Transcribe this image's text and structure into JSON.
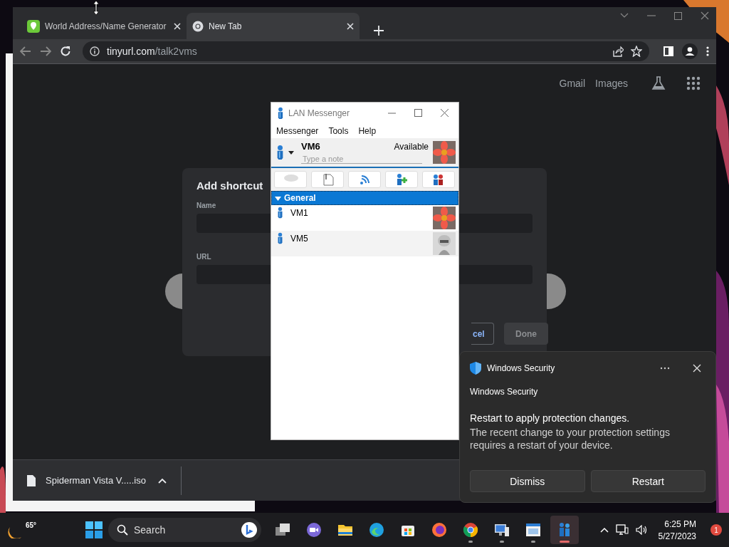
{
  "browser": {
    "tabs": [
      {
        "title": "World Address/Name Generator",
        "selected": false
      },
      {
        "title": "New Tab",
        "selected": true
      }
    ],
    "address": {
      "host": "tinyurl.com",
      "path": "/talk2vms"
    },
    "header_links": [
      "Gmail",
      "Images"
    ],
    "dialog": {
      "title": "Add shortcut",
      "fields": [
        {
          "label": "Name"
        },
        {
          "label": "URL"
        }
      ],
      "buttons": [
        {
          "label": "cel",
          "disabled": false
        },
        {
          "label": "Done",
          "disabled": true
        }
      ]
    },
    "download": {
      "filename": "Spiderman Vista V.....iso"
    }
  },
  "messenger": {
    "title": "LAN Messenger",
    "menu": [
      "Messenger",
      "Tools",
      "Help"
    ],
    "user": {
      "name": "VM6",
      "status": "Available",
      "note_placeholder": "Type a note"
    },
    "groups": [
      {
        "name": "General",
        "expanded": true,
        "contacts": [
          {
            "name": "VM1"
          },
          {
            "name": "VM5"
          }
        ]
      }
    ]
  },
  "notification": {
    "app": "Windows Security",
    "source": "Windows Security",
    "title": "Restart to apply protection changes.",
    "body": "The recent change to your protection settings requires a restart of your device.",
    "buttons": [
      "Dismiss",
      "Restart"
    ]
  },
  "taskbar": {
    "weather": "65°",
    "search_placeholder": "Search",
    "apps": [
      {
        "kind": "taskview",
        "running": false,
        "selected": false
      },
      {
        "kind": "chat",
        "running": false,
        "selected": false
      },
      {
        "kind": "folder",
        "running": false,
        "selected": false
      },
      {
        "kind": "edge",
        "running": false,
        "selected": false
      },
      {
        "kind": "store",
        "running": false,
        "selected": false
      },
      {
        "kind": "firefox",
        "running": false,
        "selected": false
      },
      {
        "kind": "chrome",
        "running": true,
        "selected": false
      },
      {
        "kind": "computer",
        "running": true,
        "selected": false
      },
      {
        "kind": "window",
        "running": true,
        "selected": false
      },
      {
        "kind": "messenger",
        "running": true,
        "selected": true
      }
    ],
    "time": "6:25 PM",
    "date": "5/27/2023",
    "badge": "1"
  }
}
